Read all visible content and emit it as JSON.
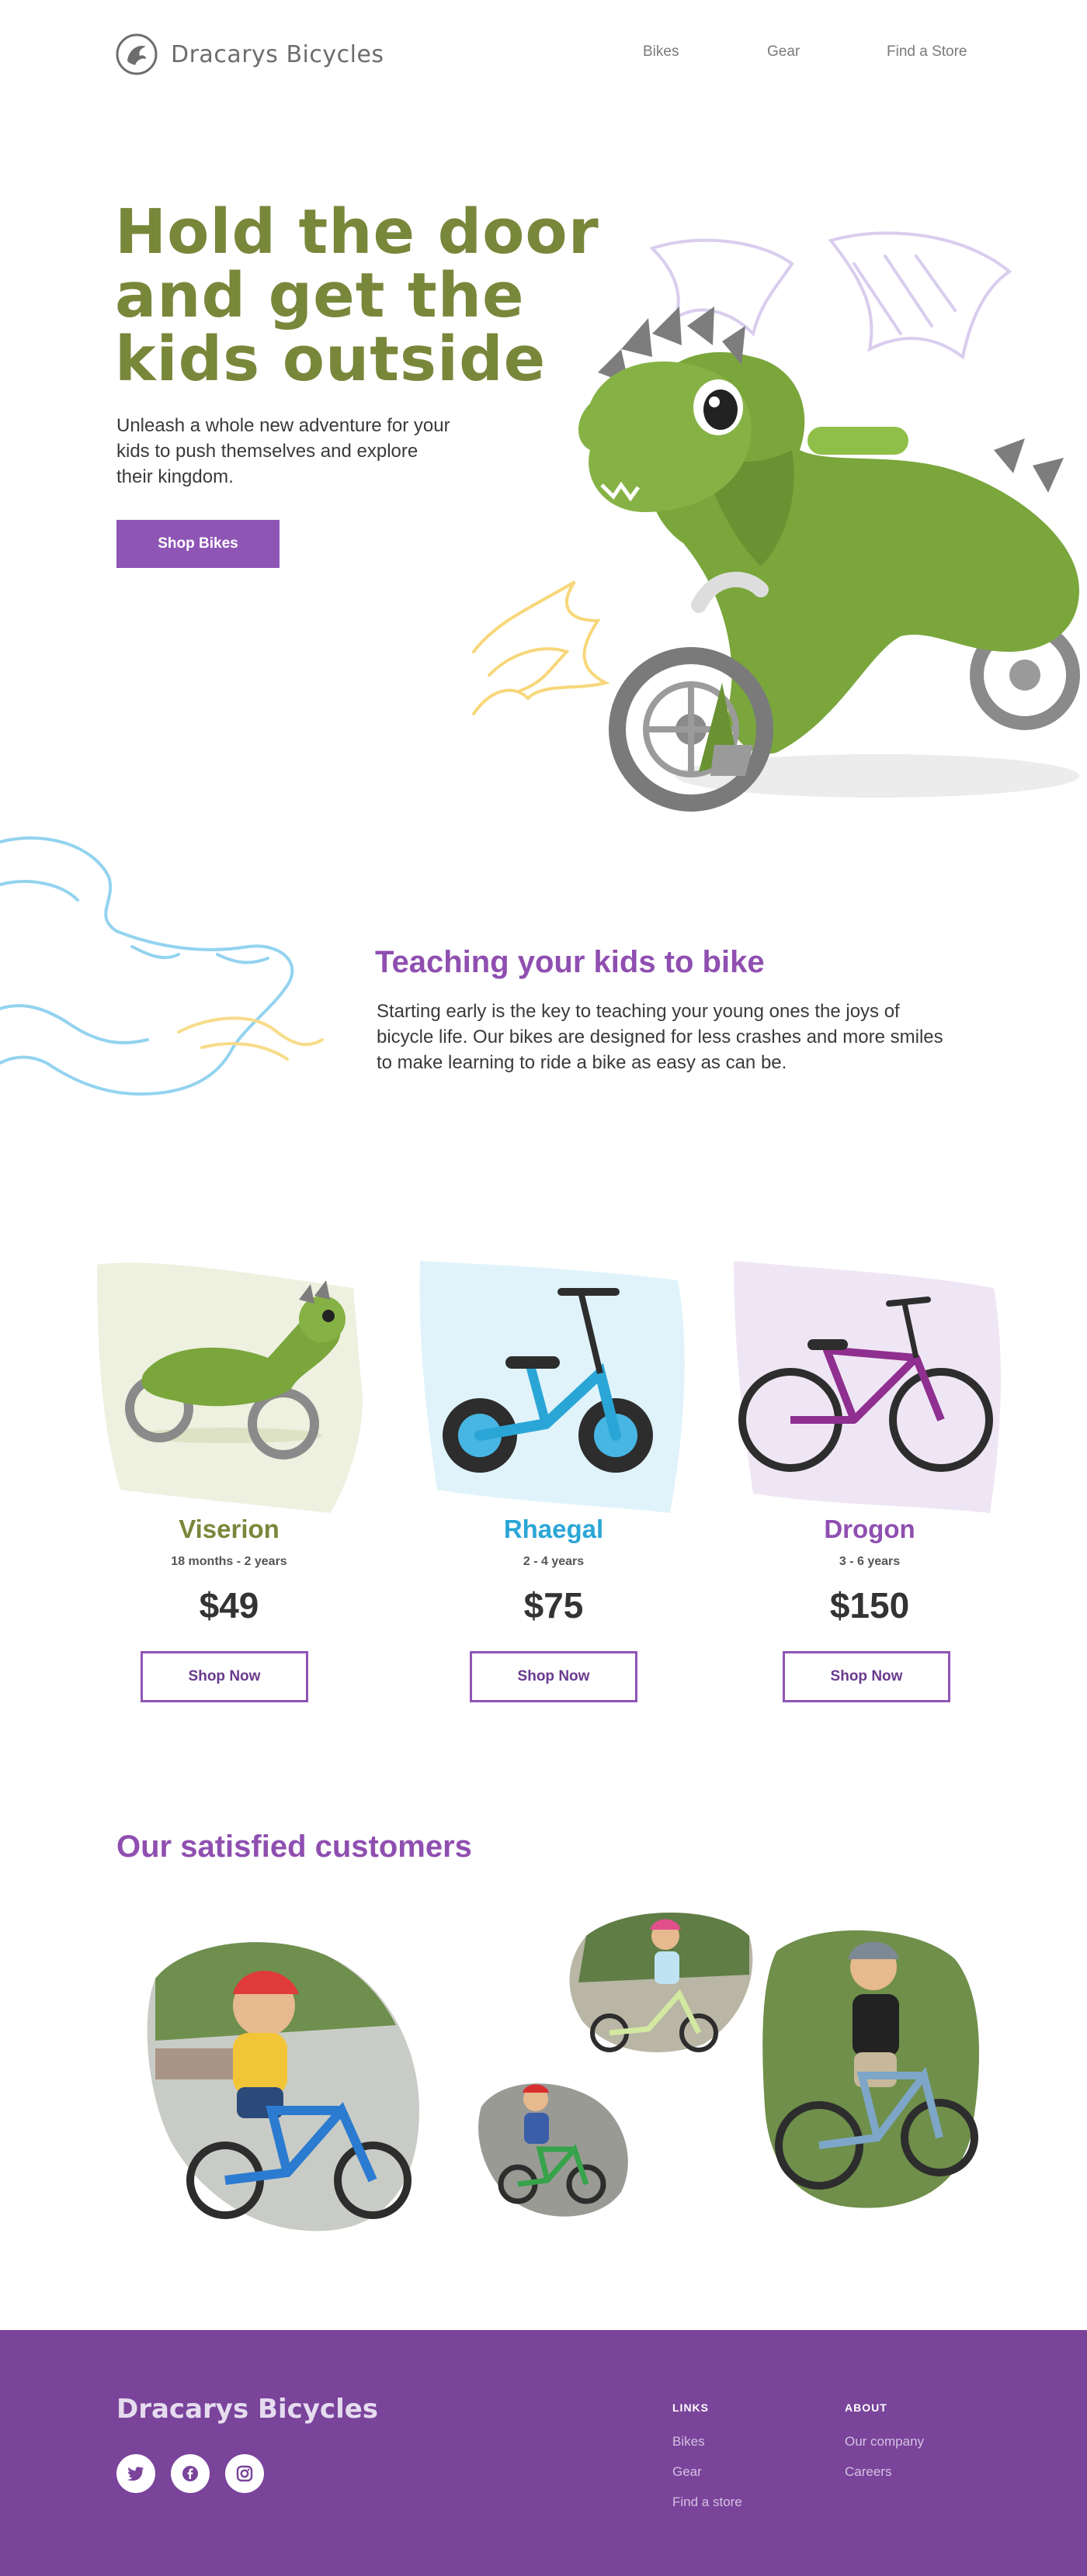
{
  "brand": {
    "name": "Dracarys Bicycles"
  },
  "nav": {
    "items": [
      {
        "label": "Bikes"
      },
      {
        "label": "Gear"
      },
      {
        "label": "Find a Store"
      }
    ]
  },
  "hero": {
    "title_lines": [
      "Hold the door",
      "and get the",
      "kids outside"
    ],
    "subtitle": "Unleash a whole new adventure for your kids to push themselves and explore their kingdom.",
    "cta_label": "Shop Bikes"
  },
  "teaching": {
    "title": "Teaching your kids to bike",
    "body": "Starting early is the key to teaching your young ones the joys of bicycle life. Our bikes are designed for less crashes and more smiles to make learning to ride a bike as easy as can be."
  },
  "products": [
    {
      "name": "Viserion",
      "age": "18 months - 2 years",
      "price": "$49",
      "button": "Shop Now",
      "color": "#78873a",
      "swatch": "#eef0e0"
    },
    {
      "name": "Rhaegal",
      "age": "2 - 4 years",
      "price": "$75",
      "button": "Shop Now",
      "color": "#2aa6d6",
      "swatch": "#e0f3fb"
    },
    {
      "name": "Drogon",
      "age": "3 - 6 years",
      "price": "$150",
      "button": "Shop Now",
      "color": "#8f4fb0",
      "swatch": "#efe6f5"
    }
  ],
  "customers": {
    "title": "Our satisfied customers"
  },
  "footer": {
    "brand": "Dracarys Bicycles",
    "social": [
      "twitter-icon",
      "facebook-icon",
      "instagram-icon"
    ],
    "links_heading": "LINKS",
    "links": [
      "Bikes",
      "Gear",
      "Find a store"
    ],
    "about_heading": "ABOUT",
    "about": [
      "Our company",
      "Careers"
    ]
  },
  "colors": {
    "accent_purple": "#8f55b5",
    "hero_green": "#78873a",
    "footer_bg": "#7a449b"
  }
}
